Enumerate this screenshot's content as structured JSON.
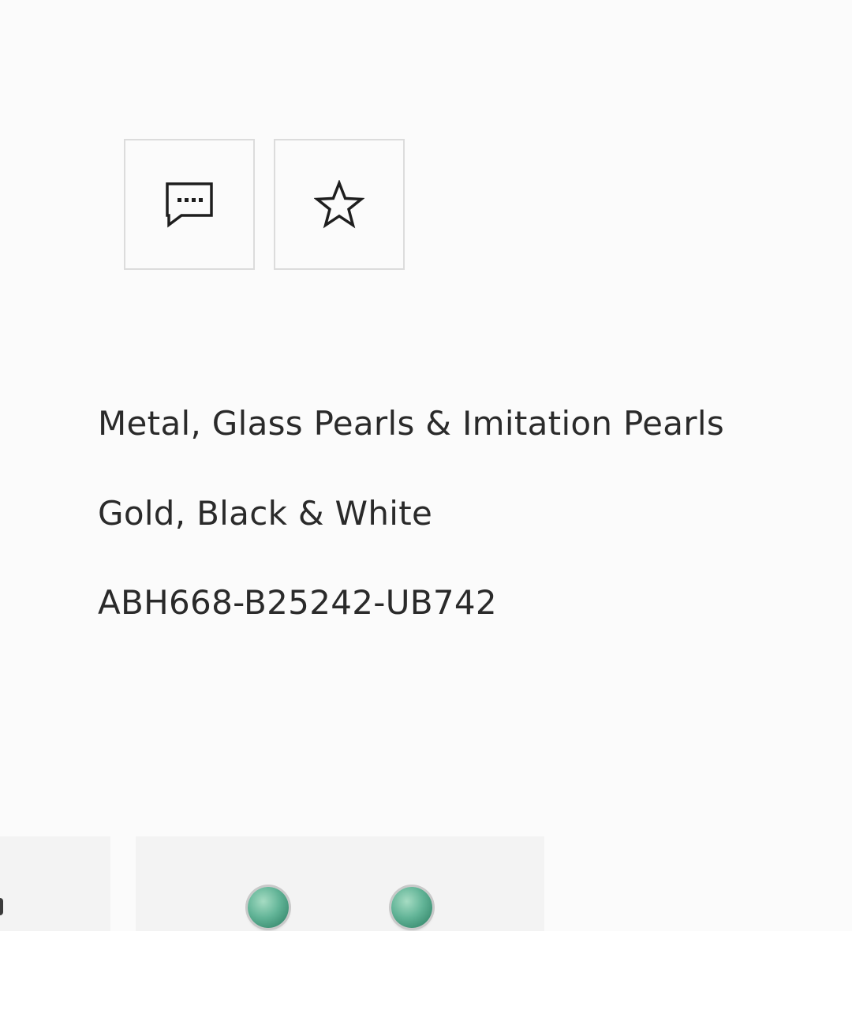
{
  "actions": {
    "chat_icon": "chat-bubble-dots",
    "favorite_icon": "star-outline"
  },
  "details": {
    "material": "Metal, Glass Pearls & Imitation Pearls",
    "color": "Gold, Black & White",
    "reference": "ABH668-B25242-UB742"
  },
  "gallery": {
    "thumbnails": [
      {
        "item": "previous-product-thumbnail"
      },
      {
        "item": "earrings-green-stone-thumbnail",
        "gem_color": "#5fb393"
      }
    ]
  },
  "colors": {
    "background": "#fbfbfb",
    "border": "#dcdcdc",
    "text": "#2a2a2a"
  }
}
